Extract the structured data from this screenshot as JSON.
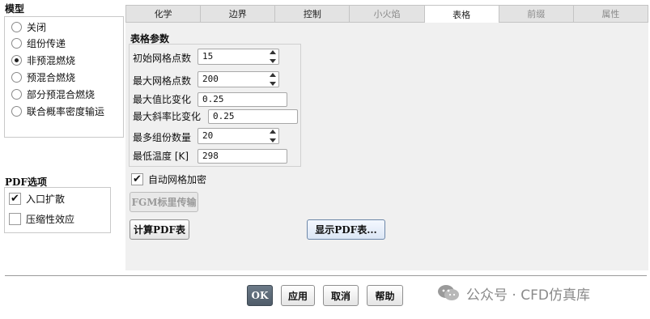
{
  "model": {
    "title": "模型",
    "options": [
      "关闭",
      "组份传递",
      "非预混燃烧",
      "预混合燃烧",
      "部分预混合燃烧",
      "联合概率密度输运"
    ],
    "selected_index": 2
  },
  "pdf_options": {
    "title": "PDF选项",
    "items": [
      {
        "label": "入口扩散",
        "checked": true
      },
      {
        "label": "压缩性效应",
        "checked": false
      }
    ]
  },
  "tabs": [
    {
      "label": "化学",
      "state": "normal"
    },
    {
      "label": "边界",
      "state": "normal"
    },
    {
      "label": "控制",
      "state": "normal"
    },
    {
      "label": "小火焰",
      "state": "disabled"
    },
    {
      "label": "表格",
      "state": "active"
    },
    {
      "label": "前缀",
      "state": "disabled"
    },
    {
      "label": "属性",
      "state": "disabled"
    }
  ],
  "table_params": {
    "title": "表格参数",
    "initial_grid_points": {
      "label": "初始网格点数",
      "value": "15"
    },
    "max_grid_points": {
      "label": "最大网格点数",
      "value": "200"
    },
    "max_value_ratio": {
      "label": "最大值比变化",
      "value": "0.25"
    },
    "max_slope_ratio": {
      "label": "最大斜率比变化",
      "value": "0.25"
    },
    "max_species": {
      "label": "最多组份数量",
      "value": "20"
    },
    "min_temperature": {
      "label": "最低温度 [K]",
      "value": "298"
    }
  },
  "auto_refine": {
    "label": "自动网格加密",
    "checked": true
  },
  "buttons": {
    "fgm_transport": "FGM标里传输",
    "compute_pdf": "计算PDF表",
    "show_pdf": "显示PDF表...",
    "ok": "OK",
    "apply": "应用",
    "cancel": "取消",
    "help": "帮助"
  },
  "watermark": {
    "text": "公众号 · CFD仿真库",
    "icon": "wechat-icon"
  }
}
